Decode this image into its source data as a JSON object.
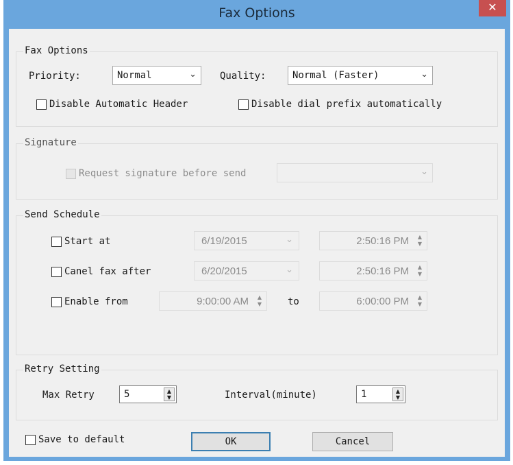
{
  "window": {
    "title": "Fax Options",
    "close_glyph": "✕"
  },
  "fax_options": {
    "legend": "Fax Options",
    "priority_label": "Priority:",
    "priority_value": "Normal",
    "quality_label": "Quality:",
    "quality_value": "Normal (Faster)",
    "disable_header_label": "Disable Automatic Header",
    "disable_prefix_label": "Disable dial prefix automatically"
  },
  "signature": {
    "legend": "Signature",
    "request_label": "Request signature before send",
    "dropdown_value": ""
  },
  "send_schedule": {
    "legend": "Send Schedule",
    "start_at_label": "Start at",
    "start_date": "6/19/2015",
    "start_time": "2:50:16 PM",
    "cancel_after_label": "Canel fax after",
    "cancel_date": "6/20/2015",
    "cancel_time": "2:50:16 PM",
    "enable_from_label": "Enable from",
    "enable_from_time": "9:00:00 AM",
    "to_label": "to",
    "enable_to_time": "6:00:00 PM"
  },
  "retry": {
    "legend": "Retry Setting",
    "max_retry_label": "Max Retry",
    "max_retry_value": "5",
    "interval_label": "Interval(minute)",
    "interval_value": "1"
  },
  "footer": {
    "save_default_label": "Save to default",
    "ok_label": "OK",
    "cancel_label": "Cancel"
  },
  "icons": {
    "dropdown_arrow": "chevron-down-icon",
    "spinner": "spin-arrows-icon"
  },
  "colors": {
    "titlebar": "#6aa6dd",
    "close_button": "#c75050",
    "client": "#f0f0f0",
    "default_button_border": "#3c7fb1"
  }
}
